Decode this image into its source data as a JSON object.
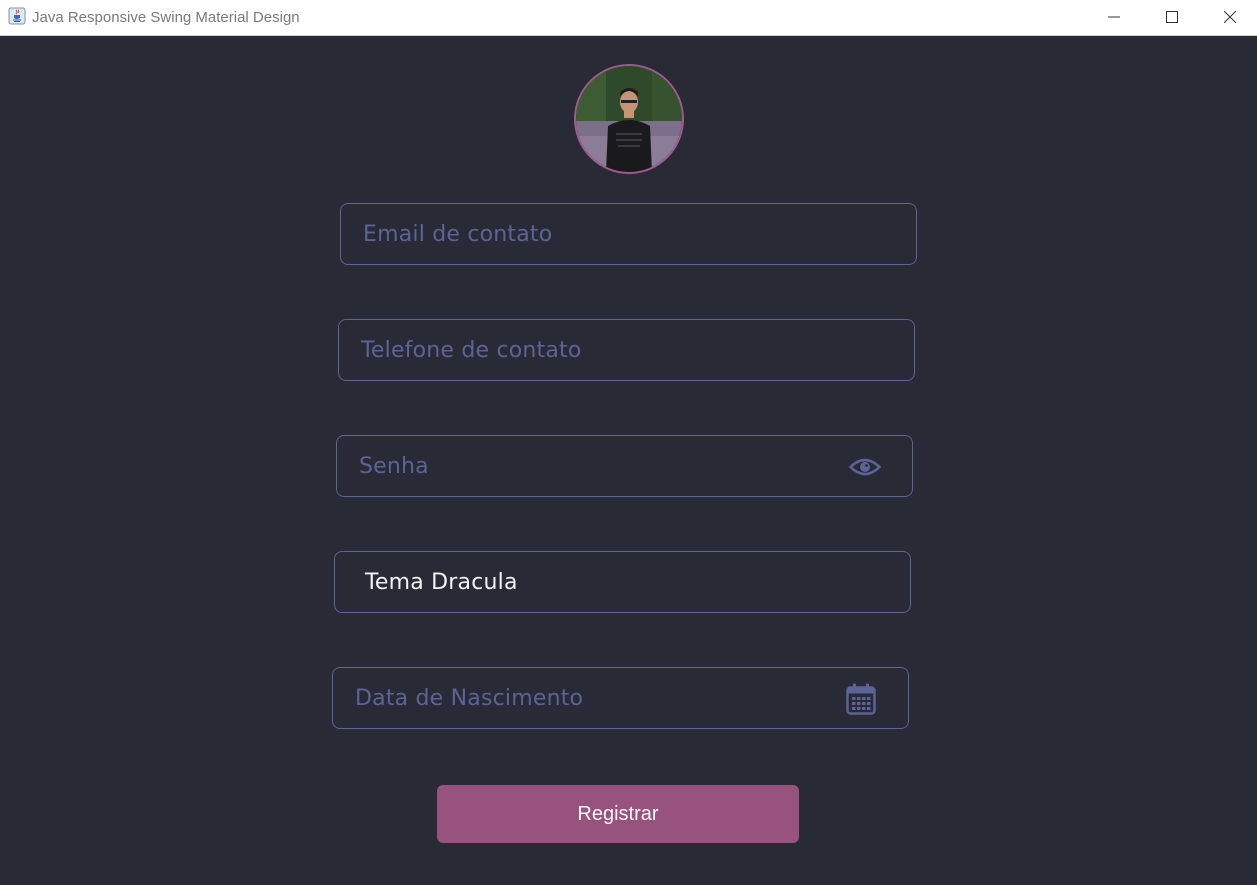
{
  "window": {
    "title": "Java Responsive Swing Material Design",
    "controls": [
      "minimize-icon",
      "maximize-icon",
      "close-icon"
    ]
  },
  "form": {
    "email": {
      "placeholder": "Email de contato",
      "value": ""
    },
    "telefone": {
      "placeholder": "Telefone de contato",
      "value": ""
    },
    "senha": {
      "placeholder": "Senha",
      "value": "",
      "icon": "eye-icon"
    },
    "tema": {
      "value": "Tema Dracula"
    },
    "nascimento": {
      "placeholder": "Data de Nascimento",
      "value": "",
      "icon": "calendar-icon"
    },
    "submit_label": "Registrar"
  },
  "colors": {
    "background": "#282a36",
    "field_border": "#5c6396",
    "placeholder": "#5c6396",
    "button": "#97527d",
    "avatar_border": "#a05a8d"
  }
}
